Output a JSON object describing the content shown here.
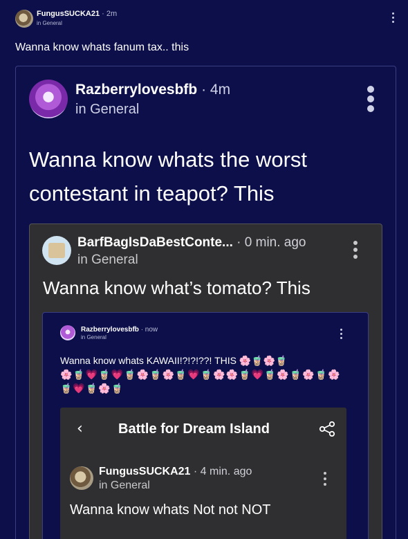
{
  "post": {
    "username": "FungusSUCKA21",
    "time": "· 2m",
    "category": "in General",
    "text": "Wanna know whats fanum tax.. this"
  },
  "repost1": {
    "username": "Razberrylovesbfb",
    "time": "· 4m",
    "category": "in General",
    "text": "Wanna know whats the worst contestant in teapot? This"
  },
  "repost2": {
    "username": "BarfBagIsDaBestConte...",
    "time": "· 0 min. ago",
    "category": "in General",
    "text": "Wanna know what’s tomato? This"
  },
  "repost3": {
    "username": "Razberrylovesbfb",
    "time": "· now",
    "category": "in General",
    "text": "Wanna know whats KAWAII!?!?!??! THIS 🌸🧋🌸🧋",
    "emoji_line2": "🌸🧋💗🧋💗🧋🌸🧋🌸🧋💗🧋🌸🌸🧋💗🧋🌸🧋🌸🧋🌸",
    "emoji_line3": "🧋💗🧋🌸🧋"
  },
  "embed": {
    "title": "Battle for Dream Island",
    "back_icon": "‹",
    "username": "FungusSUCKA21",
    "time": "· 4 min. ago",
    "category": "in General",
    "text": "Wanna know whats Not not NOT"
  }
}
